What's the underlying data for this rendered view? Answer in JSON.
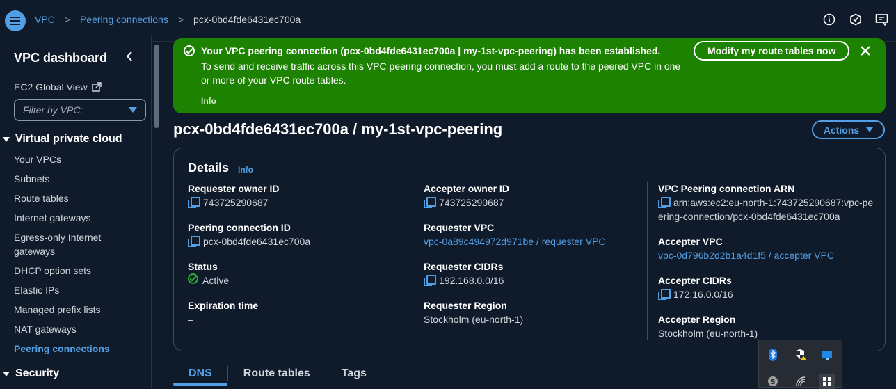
{
  "breadcrumb": {
    "root": "VPC",
    "section": "Peering connections",
    "current": "pcx-0bd4fde6431ec700a"
  },
  "top_icons": [
    "info-icon",
    "security-shield-icon",
    "feedback-icon"
  ],
  "sidebar": {
    "title": "VPC dashboard",
    "global_view": "EC2 Global View",
    "filter_placeholder": "Filter by VPC:",
    "section_vpc": "Virtual private cloud",
    "items": [
      "Your VPCs",
      "Subnets",
      "Route tables",
      "Internet gateways",
      "Egress-only Internet gateways",
      "DHCP option sets",
      "Elastic IPs",
      "Managed prefix lists",
      "NAT gateways",
      "Peering connections"
    ],
    "active_item": "Peering connections",
    "section_security": "Security"
  },
  "flash": {
    "heading": "Your VPC peering connection (pcx-0bd4fde6431ec700a | my-1st-vpc-peering) has been established.",
    "body": "To send and receive traffic across this VPC peering connection, you must add a route to the peered VPC in one or more of your VPC route tables.",
    "info": "Info",
    "button": "Modify my route tables now",
    "color": "#1d8102"
  },
  "page": {
    "title": "pcx-0bd4fde6431ec700a / my-1st-vpc-peering",
    "actions": "Actions"
  },
  "details": {
    "title": "Details",
    "info": "Info",
    "requester_owner_label": "Requester owner ID",
    "requester_owner": "743725290687",
    "peering_id_label": "Peering connection ID",
    "peering_id": "pcx-0bd4fde6431ec700a",
    "status_label": "Status",
    "status": "Active",
    "expiration_label": "Expiration time",
    "expiration": "–",
    "accepter_owner_label": "Accepter owner ID",
    "accepter_owner": "743725290687",
    "requester_vpc_label": "Requester VPC",
    "requester_vpc": "vpc-0a89c494972d971be / requester VPC",
    "requester_cidrs_label": "Requester CIDRs",
    "requester_cidrs": "192.168.0.0/16",
    "requester_region_label": "Requester Region",
    "requester_region": "Stockholm (eu-north-1)",
    "arn_label": "VPC Peering connection ARN",
    "arn": "arn:aws:ec2:eu-north-1:743725290687:vpc-peering-connection/pcx-0bd4fde6431ec700a",
    "accepter_vpc_label": "Accepter VPC",
    "accepter_vpc": "vpc-0d796b2d2b1a4d1f5 / accepter VPC",
    "accepter_cidrs_label": "Accepter CIDRs",
    "accepter_cidrs": "172.16.0.0/16",
    "accepter_region_label": "Accepter Region",
    "accepter_region": "Stockholm (eu-north-1)"
  },
  "tabs": [
    "DNS",
    "Route tables",
    "Tags"
  ],
  "accent_color": "#539fe5",
  "status_color": "#29ad32"
}
